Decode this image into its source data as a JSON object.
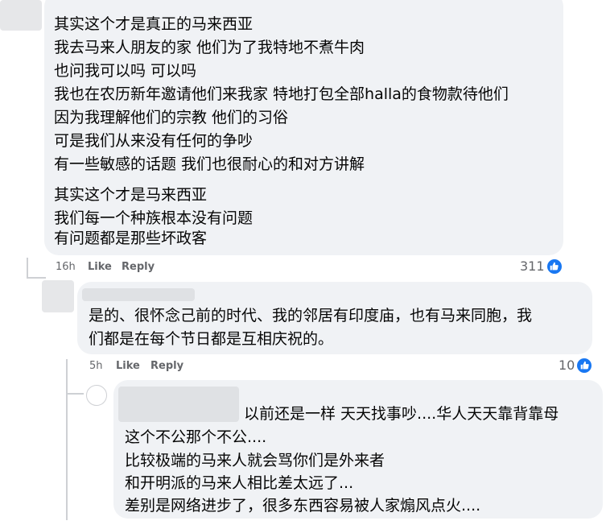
{
  "comments": [
    {
      "lines": [
        "其实这个才是真正的马来西亚",
        "我去马来人朋友的家 他们为了我特地不煮牛肉",
        "也问我可以吗 可以吗",
        "我也在农历新年邀请他们来我家 特地打包全部halla的食物款待他们",
        "因为我理解他们的宗教 他们的习俗",
        "可是我们从来没有任何的争吵",
        "有一些敏感的话题 我们也很耐心的和对方讲解",
        "其实这个才是马来西亚",
        "我们每一个种族根本没有问题",
        "有问题都是那些坏政客"
      ],
      "time": "16h",
      "like_label": "Like",
      "reply_label": "Reply",
      "reaction_count": "311"
    },
    {
      "lines": [
        "是的、很怀念己前的时代、我的邻居有印度庙，也有马来同胞，我",
        "们都是在每个节日都是互相庆祝的。"
      ],
      "time": "5h",
      "like_label": "Like",
      "reply_label": "Reply",
      "reaction_count": "10"
    },
    {
      "lines": [
        "以前还是一样 天天找事吵....华人天天靠背靠母",
        "这个不公那个不公....",
        "比较极端的马来人就会骂你们是外来者",
        "和开明派的马来人相比差太远了...",
        "差别是网络进步了，很多东西容易被人家煽风点火...."
      ]
    }
  ],
  "colors": {
    "bubble": "#f0f2f5",
    "like_blue": "#1877f2",
    "meta": "#65676b"
  },
  "icons": [
    "like-icon"
  ]
}
